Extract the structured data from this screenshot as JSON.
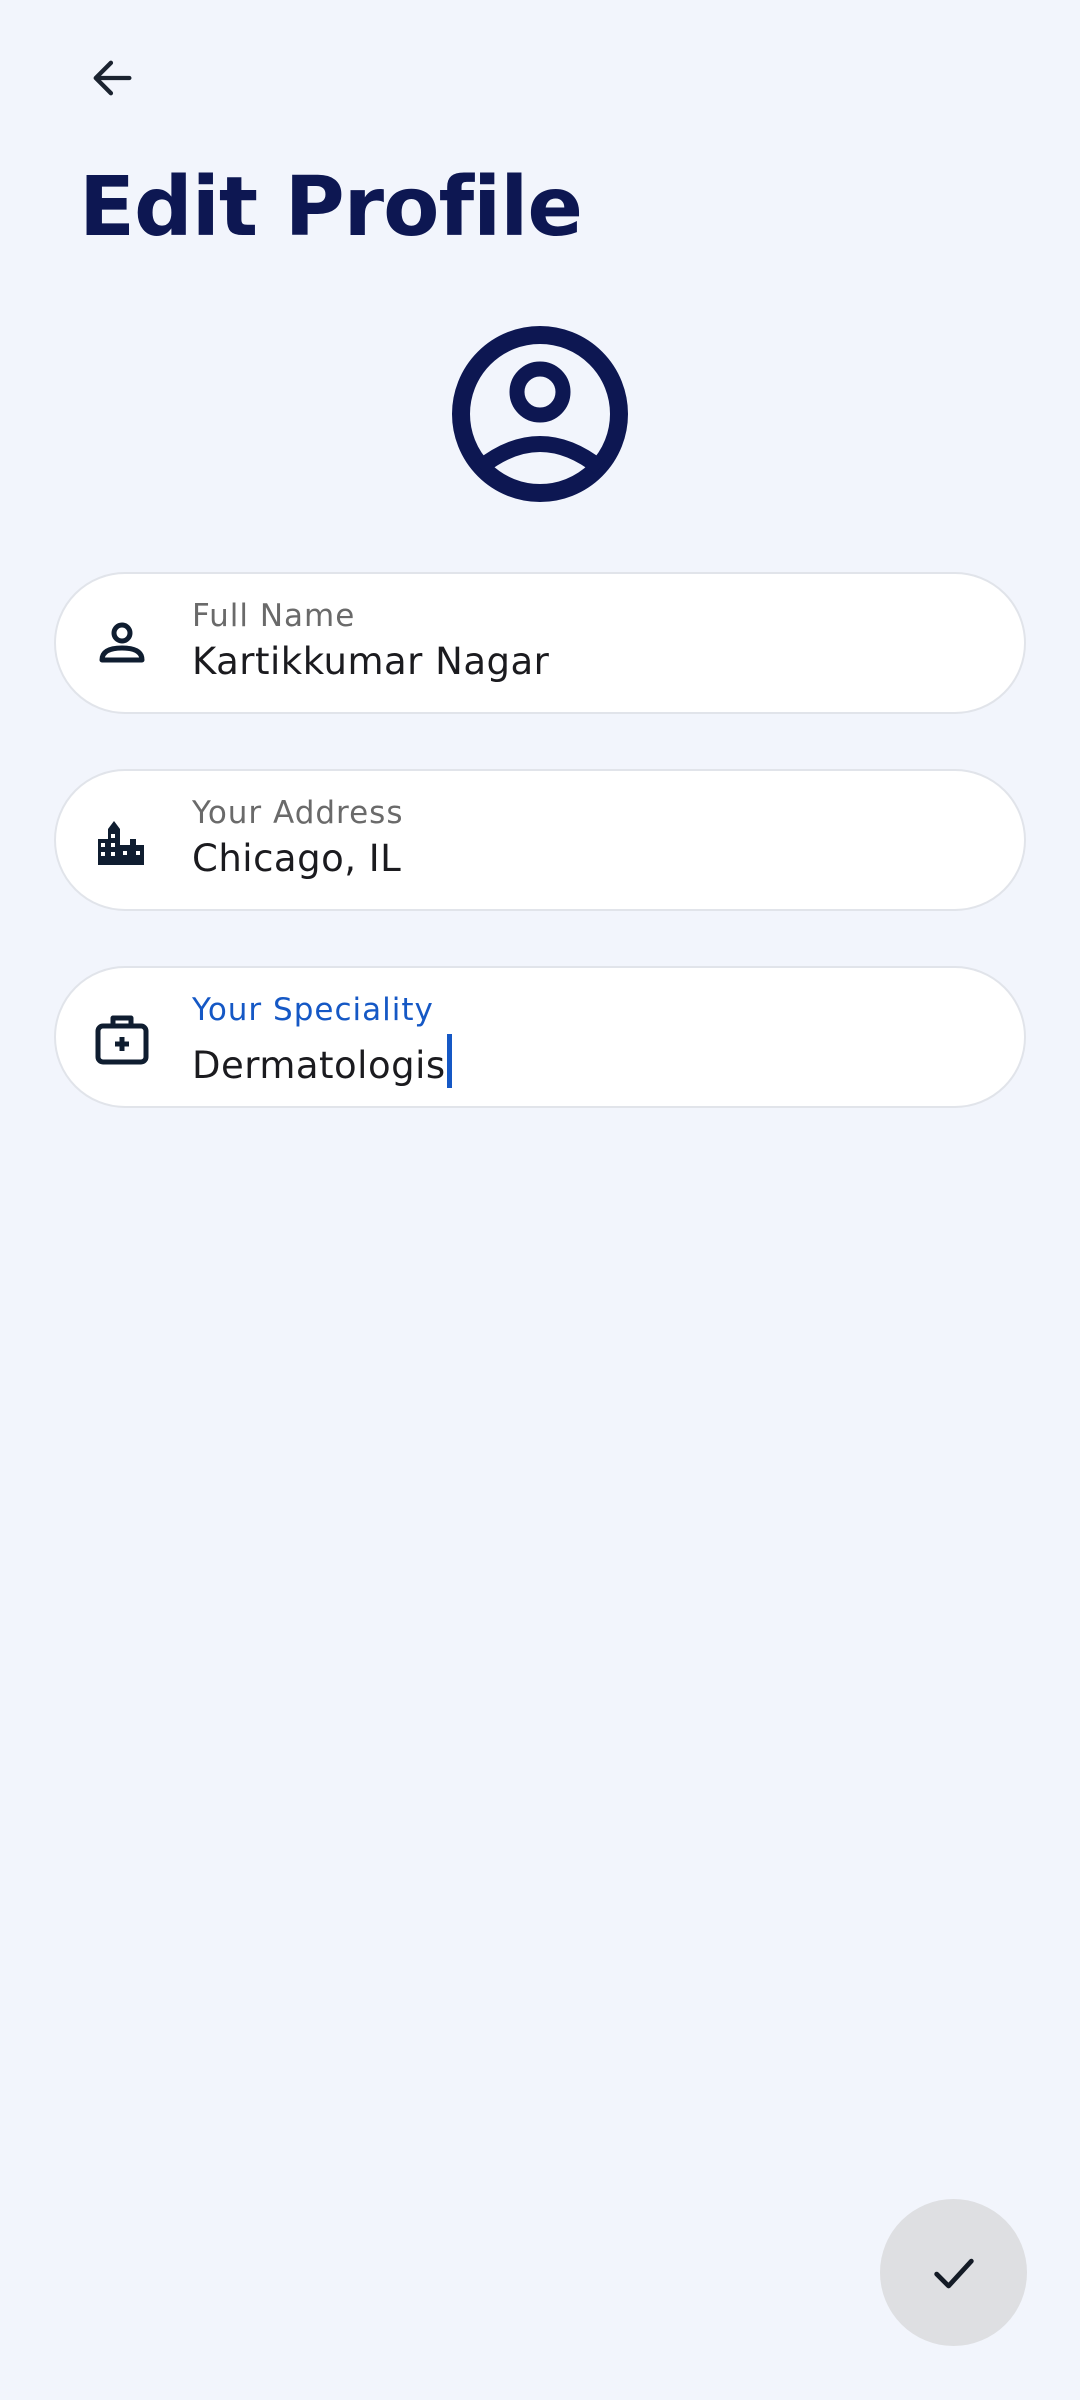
{
  "header": {
    "title": "Edit Profile"
  },
  "form": {
    "full_name": {
      "label": "Full Name",
      "value": "Kartikkumar Nagar",
      "icon": "person-icon"
    },
    "address": {
      "label": "Your Address",
      "value": "Chicago, IL",
      "icon": "building-icon"
    },
    "speciality": {
      "label": "Your Speciality",
      "value": "Dermatologis",
      "icon": "medical-bag-icon",
      "focused": true
    }
  },
  "actions": {
    "save_icon": "check-icon"
  },
  "colors": {
    "background": "#f2f5fc",
    "title": "#0d1752",
    "accent": "#1558c5",
    "field_border": "#e1e4ea",
    "fab": "#dedfe2"
  }
}
